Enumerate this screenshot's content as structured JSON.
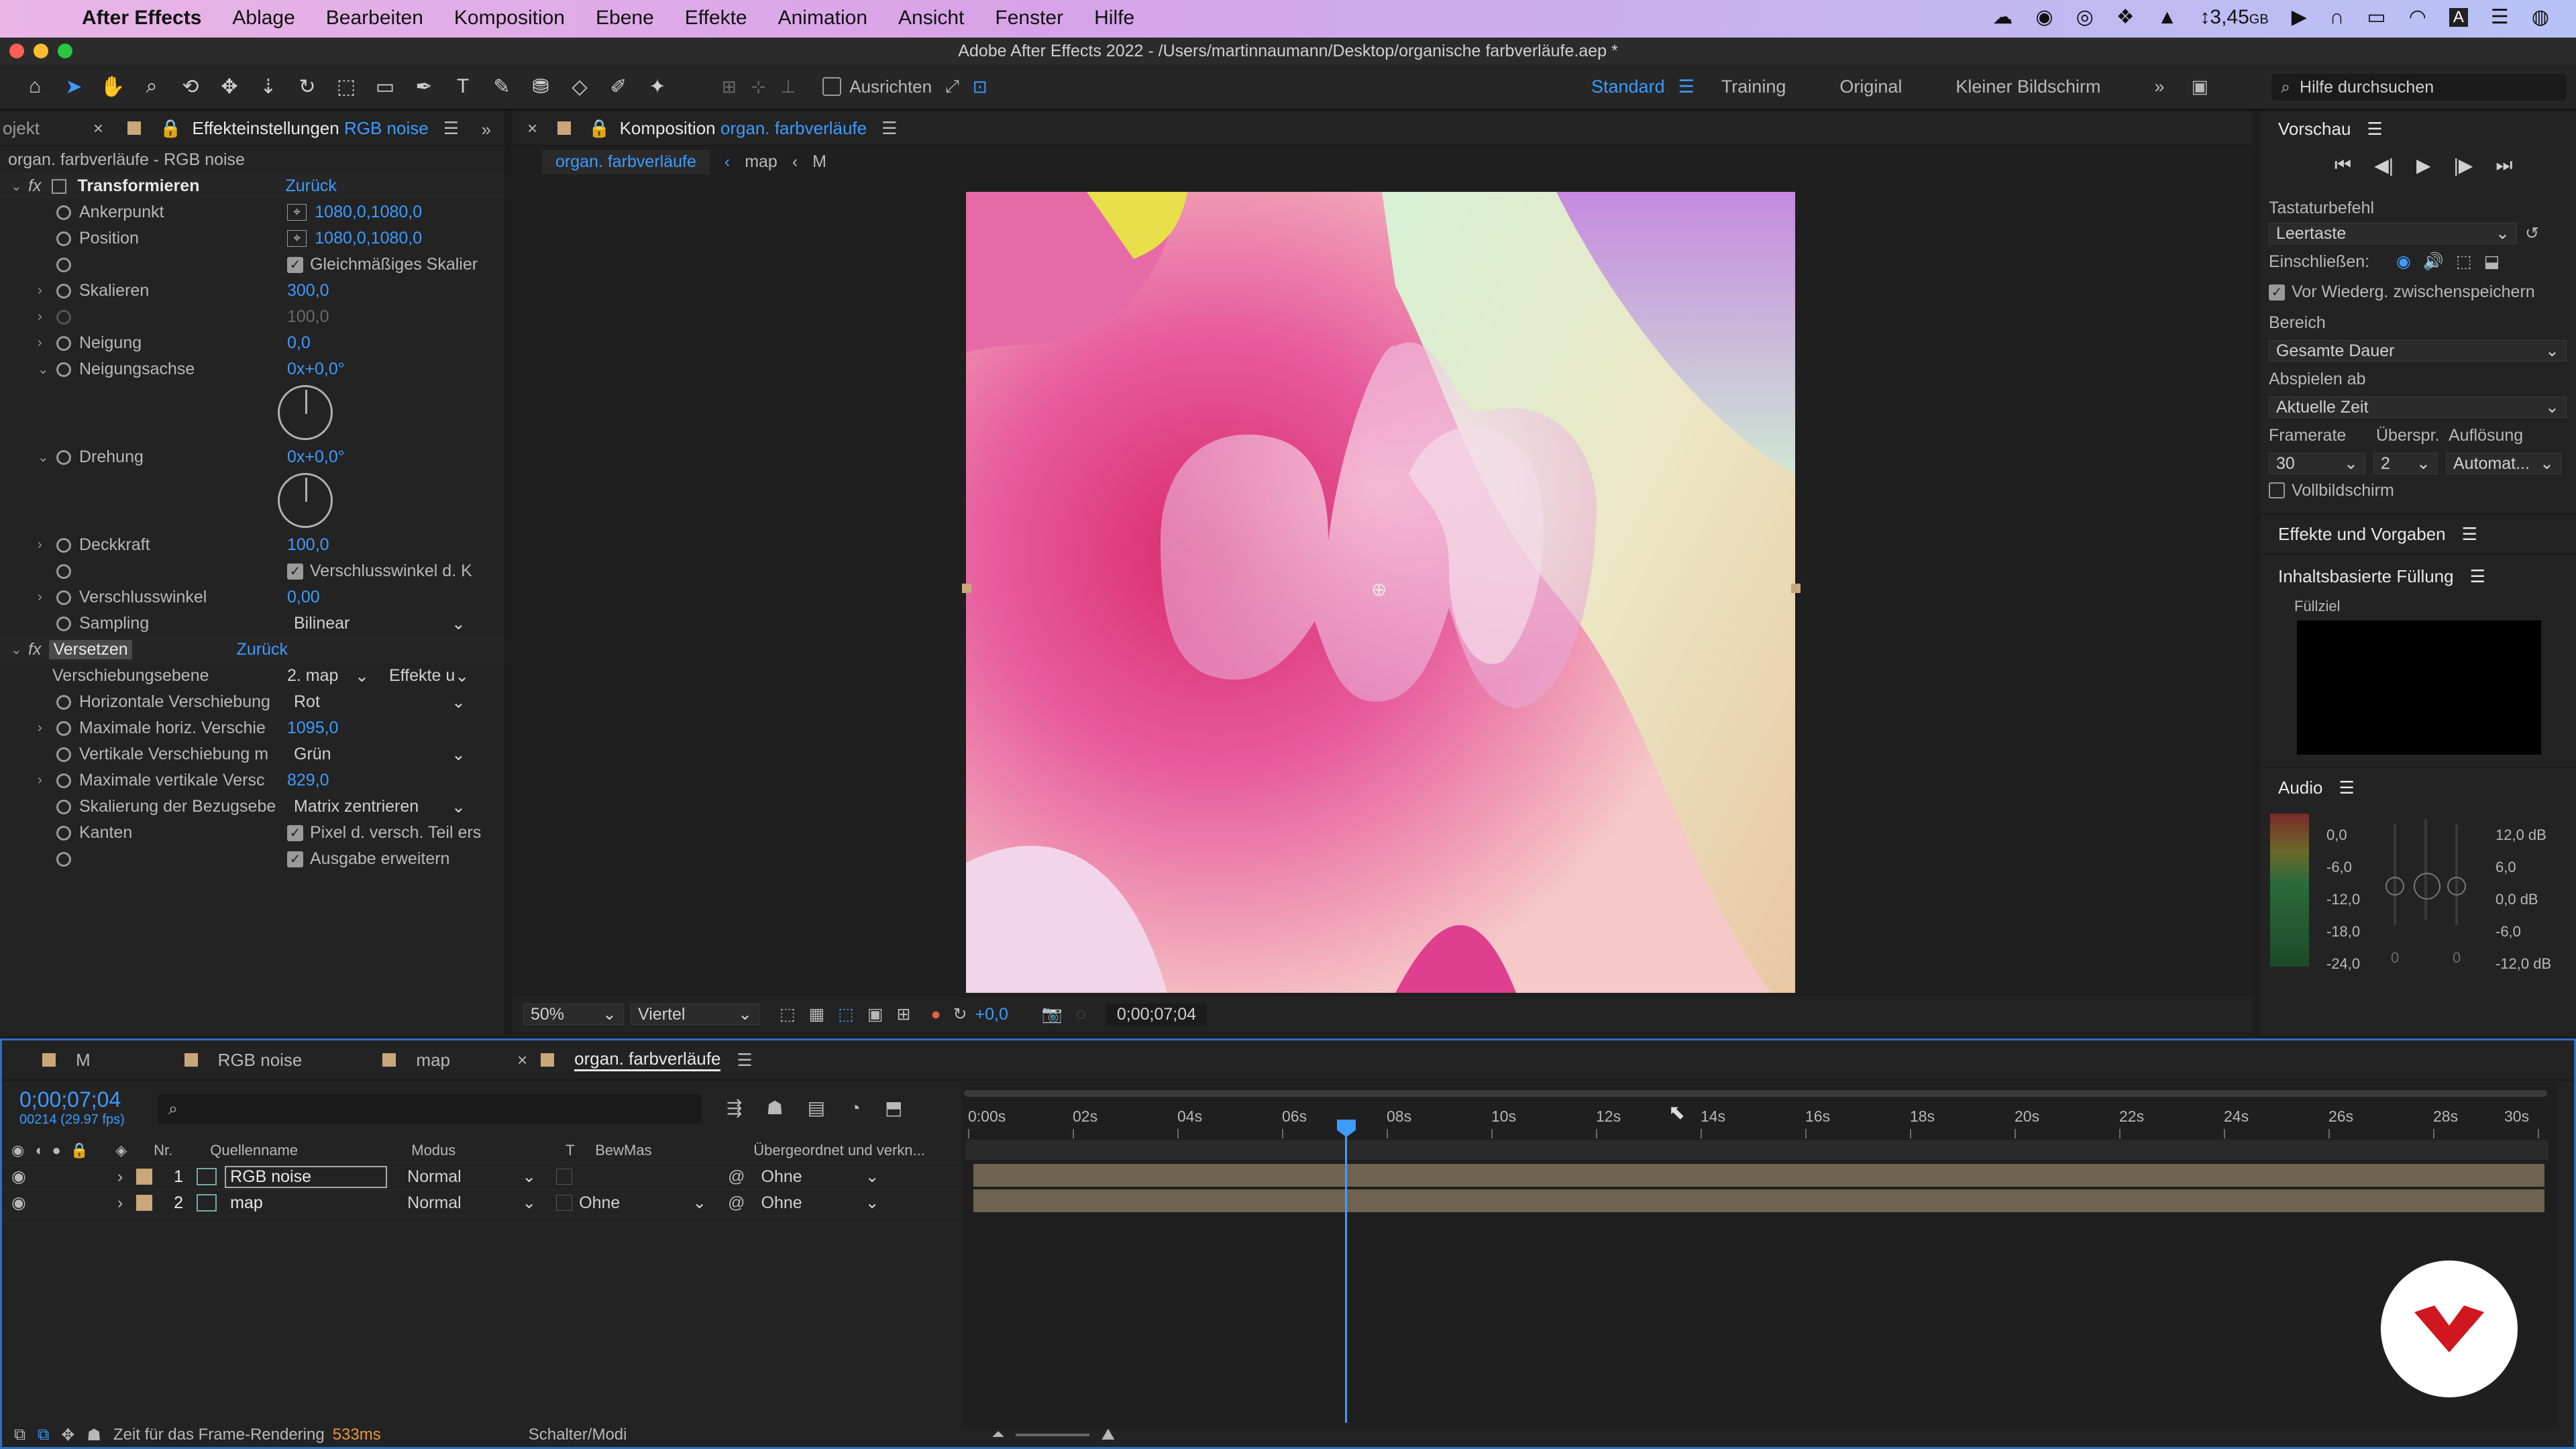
{
  "menubar": {
    "app": "After Effects",
    "items": [
      "Ablage",
      "Bearbeiten",
      "Komposition",
      "Ebene",
      "Effekte",
      "Animation",
      "Ansicht",
      "Fenster",
      "Hilfe"
    ],
    "memory": "3,45",
    "memory_unit": "GB"
  },
  "window": {
    "title": "Adobe After Effects 2022 - /Users/martinnaumann/Desktop/organische farbverläufe.aep *"
  },
  "toolbar": {
    "align_label": "Ausrichten",
    "workspaces": [
      "Standard",
      "Training",
      "Original",
      "Kleiner Bildschirm"
    ],
    "active_workspace": "Standard",
    "help_placeholder": "Hilfe durchsuchen"
  },
  "effects_panel": {
    "project_tab": "ojekt",
    "tab_prefix": "Effekteinstellungen",
    "tab_layer": "RGB noise",
    "header": "organ. farbverläufe - RGB noise",
    "transform_group": "Transformieren",
    "reset": "Zurück",
    "anchor_label": "Ankerpunkt",
    "anchor_value": "1080,0,1080,0",
    "position_label": "Position",
    "position_value": "1080,0,1080,0",
    "uniform_scale": "Gleichmäßiges Skalier",
    "scale_label": "Skalieren",
    "scale_value": "300,0",
    "scale_disabled": "100,0",
    "skew_label": "Neigung",
    "skew_value": "0,0",
    "skew_axis_label": "Neigungsachse",
    "skew_axis_value": "0x+0,0°",
    "rotation_label": "Drehung",
    "rotation_value": "0x+0,0°",
    "opacity_label": "Deckkraft",
    "opacity_value": "100,0",
    "shutter_comp": "Verschlusswinkel d. K",
    "shutter_label": "Verschlusswinkel",
    "shutter_value": "0,00",
    "sampling_label": "Sampling",
    "sampling_value": "Bilinear",
    "displace_group": "Versetzen",
    "displace_layer_label": "Verschiebungsebene",
    "displace_layer_value": "2. map",
    "displace_layer_source": "Effekte u",
    "h_disp_label": "Horizontale Verschiebung",
    "h_disp_value": "Rot",
    "max_h_label": "Maximale horiz. Verschie",
    "max_h_value": "1095,0",
    "v_disp_label": "Vertikale Verschiebung m",
    "v_disp_value": "Grün",
    "max_v_label": "Maximale vertikale Versc",
    "max_v_value": "829,0",
    "scaling_label": "Skalierung der Bezugsebe",
    "scaling_value": "Matrix zentrieren",
    "edges_label": "Kanten",
    "edges_value": "Pixel d. versch. Teil ers",
    "expand_output": "Ausgabe erweitern"
  },
  "comp_panel": {
    "tab_prefix": "Komposition",
    "tab_comp": "organ. farbverläufe",
    "breadcrumbs": [
      "organ. farbverläufe",
      "map",
      "M"
    ],
    "zoom": "50%",
    "resolution": "Viertel",
    "exposure": "+0,0",
    "timecode": "0;00;07;04"
  },
  "preview_panel": {
    "title": "Vorschau",
    "shortcut_label": "Tastaturbefehl",
    "shortcut_value": "Leertaste",
    "include_label": "Einschließen:",
    "cache_label": "Vor Wiederg. zwischenspeichern",
    "range_label": "Bereich",
    "range_value": "Gesamte Dauer",
    "play_from_label": "Abspielen ab",
    "play_from_value": "Aktuelle Zeit",
    "framerate_label": "Framerate",
    "skip_label": "Überspr.",
    "resolution_label": "Auflösung",
    "framerate_value": "30",
    "skip_value": "2",
    "resolution_value": "Automat...",
    "fullscreen_label": "Vollbildschirm",
    "effects_presets": "Effekte und Vorgaben",
    "content_fill": "Inhaltsbasierte Füllung",
    "fill_target": "Füllziel",
    "audio": "Audio",
    "audio_left": [
      "0,0",
      "-6,0",
      "-12,0",
      "-18,0",
      "-24,0"
    ],
    "audio_right": [
      "12,0 dB",
      "6,0",
      "0,0 dB",
      "-6,0",
      "-12,0 dB"
    ],
    "audio_bottom": [
      "0",
      "0"
    ]
  },
  "timeline": {
    "tabs": [
      "M",
      "RGB noise",
      "map",
      "organ. farbverläufe"
    ],
    "active_tab": "organ. farbverläufe",
    "timecode": "0;00;07;04",
    "frames": "00214 (29.97 fps)",
    "col_nr": "Nr.",
    "col_source": "Quellenname",
    "col_mode": "Modus",
    "col_t": "T",
    "col_trkmat": "BewMas",
    "col_parent": "Übergeordnet und verkn...",
    "layers": [
      {
        "nr": "1",
        "name": "RGB noise",
        "mode": "Normal",
        "trkmat": "",
        "parent": "Ohne"
      },
      {
        "nr": "2",
        "name": "map",
        "mode": "Normal",
        "trkmat": "Ohne",
        "parent": "Ohne"
      }
    ],
    "ruler": [
      "0:00s",
      "02s",
      "04s",
      "06s",
      "08s",
      "10s",
      "12s",
      "14s",
      "16s",
      "18s",
      "20s",
      "22s",
      "24s",
      "26s",
      "28s",
      "30s"
    ],
    "footer_label": "Zeit für das Frame-Rendering",
    "footer_value": "533ms",
    "footer_toggle": "Schalter/Modi"
  },
  "colors": {
    "accent": "#3d9bff",
    "label_tan": "#c9a77a",
    "layer_bar": "#6e6350",
    "orange": "#e9963e"
  }
}
